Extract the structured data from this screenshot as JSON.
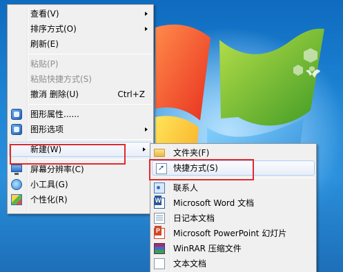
{
  "colors": {
    "highlight_box": "#e0282e",
    "menu_bg": "#f0f0f0",
    "hover_border": "#aecff7",
    "disabled_text": "#8d8d8d"
  },
  "context_menu": {
    "items": [
      {
        "label": "查看(V)",
        "submenu": true
      },
      {
        "label": "排序方式(O)",
        "submenu": true
      },
      {
        "label": "刷新(E)"
      },
      {
        "label": "粘贴(P)",
        "disabled": true
      },
      {
        "label": "粘贴快捷方式(S)",
        "disabled": true
      },
      {
        "label": "撤消 删除(U)",
        "shortcut": "Ctrl+Z"
      },
      {
        "label": "图形属性......",
        "icon": "graphics-icon"
      },
      {
        "label": "图形选项",
        "icon": "graphics-icon",
        "submenu": true
      },
      {
        "label": "新建(W)",
        "submenu": true,
        "highlighted": true
      },
      {
        "label": "屏幕分辨率(C)",
        "icon": "monitor-icon"
      },
      {
        "label": "小工具(G)",
        "icon": "gadget-icon"
      },
      {
        "label": "个性化(R)",
        "icon": "personalize-icon"
      }
    ]
  },
  "new_submenu": {
    "items": [
      {
        "label": "文件夹(F)",
        "icon": "folder-icon"
      },
      {
        "label": "快捷方式(S)",
        "icon": "shortcut-icon",
        "highlighted": true
      },
      {
        "label": "联系人",
        "icon": "contact-icon"
      },
      {
        "label": "Microsoft Word 文档",
        "icon": "word-icon"
      },
      {
        "label": "日记本文档",
        "icon": "journal-icon"
      },
      {
        "label": "Microsoft PowerPoint 幻灯片",
        "icon": "powerpoint-icon"
      },
      {
        "label": "WinRAR 压缩文件",
        "icon": "winrar-icon"
      },
      {
        "label": "文本文档",
        "icon": "text-document-icon"
      }
    ]
  }
}
